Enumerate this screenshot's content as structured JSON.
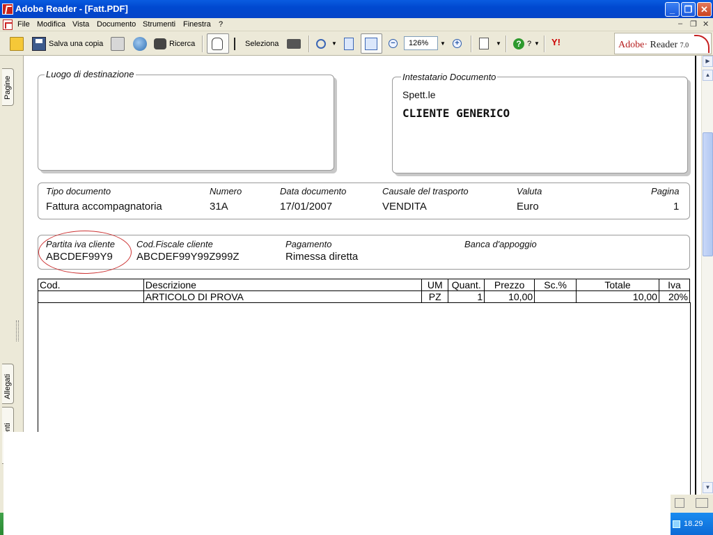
{
  "window": {
    "title": "Adobe Reader - [Fatt.PDF]",
    "minimize": "_",
    "maximize": "❐",
    "close": "✕"
  },
  "menu": {
    "items": [
      "File",
      "Modifica",
      "Vista",
      "Documento",
      "Strumenti",
      "Finestra",
      "?"
    ],
    "mdi_controls": [
      "–",
      "❐",
      "✕"
    ]
  },
  "toolbar": {
    "save_copy": "Salva una copia",
    "search": "Ricerca",
    "select": "Seleziona",
    "zoom_value": "126%",
    "help_label": "?",
    "yahoo_label": "Y!",
    "logo": {
      "adobe": "Adobe",
      "reader": "Reader",
      "version": "7.0"
    }
  },
  "nav_tabs": {
    "pages": "Pagine",
    "attachments": "Allegati",
    "comments": "enti"
  },
  "document": {
    "destination": {
      "label": "Luogo di destinazione"
    },
    "recipient": {
      "label": "Intestatario Documento",
      "salutation": "Spett.le",
      "name": "CLIENTE GENERICO"
    },
    "header_fields": [
      {
        "label": "Tipo documento",
        "value": "Fattura accompagnatoria"
      },
      {
        "label": "Numero",
        "value": "31A"
      },
      {
        "label": "Data documento",
        "value": "17/01/2007"
      },
      {
        "label": "Causale del trasporto",
        "value": "VENDITA"
      },
      {
        "label": "Valuta",
        "value": "Euro"
      },
      {
        "label": "Pagina",
        "value": "1"
      }
    ],
    "client_fields": [
      {
        "label": "Partita iva cliente",
        "value": "ABCDEF99Y9"
      },
      {
        "label": "Cod.Fiscale cliente",
        "value": "ABCDEF99Y99Z999Z"
      },
      {
        "label": "Pagamento",
        "value": "Rimessa diretta"
      },
      {
        "label": "Banca d'appoggio",
        "value": ""
      }
    ],
    "table": {
      "headers": [
        "Cod.",
        "Descrizione",
        "UM",
        "Quant.",
        "Prezzo",
        "Sc.%",
        "Totale",
        "Iva"
      ],
      "rows": [
        [
          "",
          "ARTICOLO DI PROVA",
          "PZ",
          "1",
          "10,00",
          "",
          "10,00",
          "20%"
        ]
      ]
    }
  },
  "taskbar": {
    "clock": "18.29"
  },
  "colors": {
    "title_blue": "#0049d0",
    "annotation_red": "#cc3333",
    "chrome": "#ece9d8"
  }
}
